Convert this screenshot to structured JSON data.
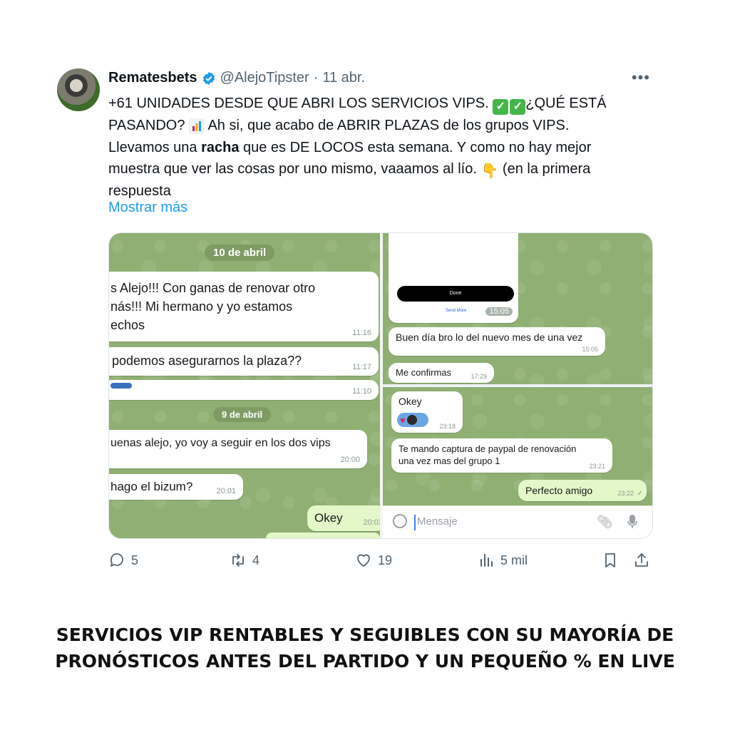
{
  "tweet": {
    "display_name": "Rematesbets",
    "handle": "@AlejoTipster",
    "separator": "·",
    "date": "11 abr.",
    "more_icon": "more-horizontal-icon",
    "text_line1_a": "+61 UNIDADES DESDE QUE ABRI LOS SERVICIOS VIPS. ",
    "text_line1_b": "¿QUÉ ESTÁ",
    "text_line2_a": "PASANDO? ",
    "text_line2_b": " Ah si, que acabo de ABRIR PLAZAS de los grupos VIPS.",
    "text_line3_a": "Llevamos una ",
    "text_line3_bold": "racha",
    "text_line3_b": " que es DE LOCOS esta semana. Y como no hay mejor",
    "text_line4_a": "muestra que ver las cosas por uno mismo, vaaamos al lío. ",
    "text_line4_b": " (en la primera",
    "text_line5": "respuesta",
    "show_more": "Mostrar más",
    "accent_color": "#1d9bf0"
  },
  "chat_left": {
    "date1": "10 de abril",
    "msg1_l1": "s Alejo!!! Con ganas de renovar otro",
    "msg1_l2": "nás!!! Mi hermano y yo estamos",
    "msg1_l3": "echos",
    "msg1_time": "11:16",
    "msg2": "podemos asegurarnos la plaza??",
    "msg2_time": "11:17",
    "msg3_time": "11:10",
    "date2": "9 de abril",
    "msg4": "uenas alejo, yo voy a seguir en los dos vips",
    "msg4_time": "20:00",
    "msg5": "hago el bizum?",
    "msg5_time": "20:01",
    "msg6": "Okey",
    "msg6_time": "20:02"
  },
  "chat_right_top": {
    "done_label": "Done",
    "send_more": "Send More",
    "img_time": "15:05",
    "msg1": "Buen día bro lo del nuevo mes de una vez",
    "msg1_time": "15:05",
    "msg2": "Me confirmas",
    "msg2_time": "17:29"
  },
  "chat_right_bottom": {
    "msg1": "Okey",
    "msg1_time": "23:18",
    "msg2_l1": "Te mando captura de paypal de renovación",
    "msg2_l2": "una vez mas del grupo 1",
    "msg2_time": "23:21",
    "msg3": "Perfecto amigo",
    "msg3_time": "23:22",
    "input_placeholder": "Mensaje"
  },
  "actions": {
    "replies": "5",
    "retweets": "4",
    "likes": "19",
    "views": "5 mil"
  },
  "caption": {
    "line1": "SERVICIOS VIP RENTABLES Y SEGUIBLES CON SU MAYORÍA DE",
    "line2": "PRONÓSTICOS ANTES DEL PARTIDO Y UN PEQUEÑO % EN LIVE"
  }
}
